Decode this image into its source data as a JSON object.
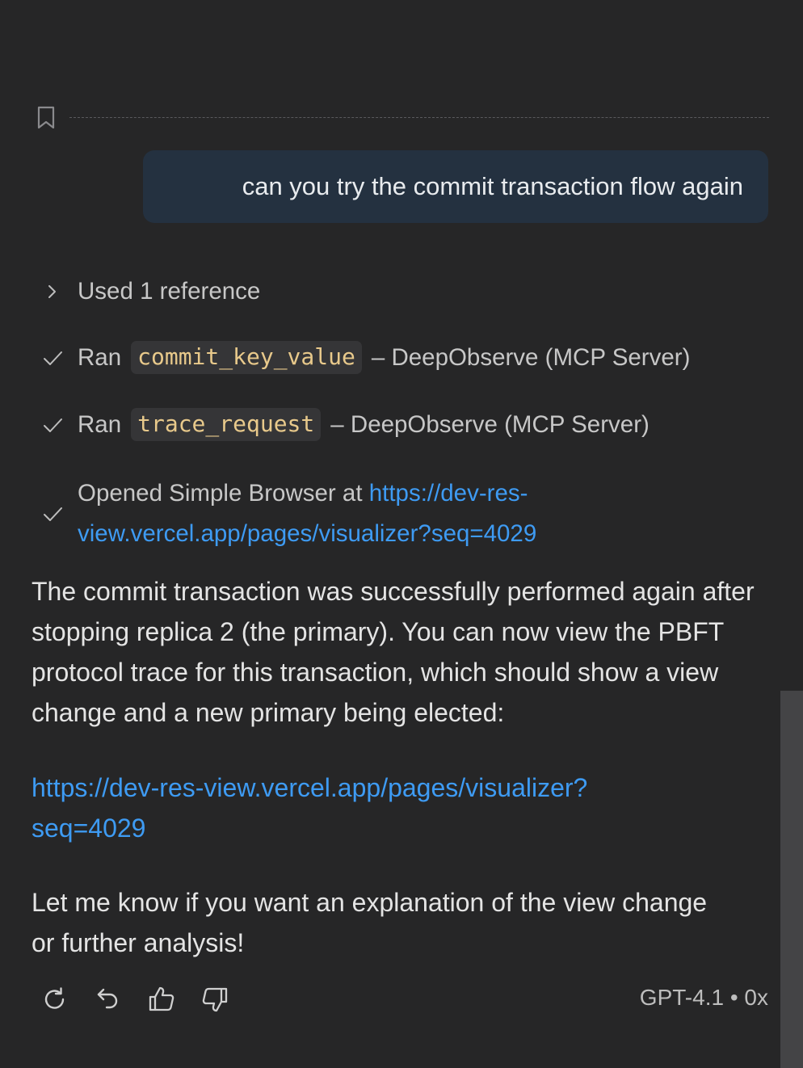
{
  "conversation": {
    "user_message": "can you try the commit transaction flow again",
    "steps": {
      "references": "Used 1 reference",
      "tool_1": {
        "prefix": "Ran",
        "tool_name": "commit_key_value",
        "suffix": "– DeepObserve (MCP Server)"
      },
      "tool_2": {
        "prefix": "Ran",
        "tool_name": "trace_request",
        "suffix": "– DeepObserve (MCP Server)"
      },
      "browser": {
        "prefix": "Opened Simple Browser at",
        "url": "https://dev-res-view.vercel.app/pages/visualizer?seq=4029"
      }
    },
    "response": {
      "paragraph_1": "The commit transaction was successfully performed again after stopping replica 2 (the primary). You can now view the PBFT protocol trace for this transaction, which should show a view change and a new primary being elected:",
      "link": "https://dev-res-view.vercel.app/pages/visualizer?seq=4029",
      "paragraph_2": "Let me know if you want an explanation of the view change or further analysis!"
    },
    "actions": {
      "retry_icon": "retry-icon",
      "undo_icon": "undo-icon",
      "thumbs_up_icon": "thumbs-up-icon",
      "thumbs_down_icon": "thumbs-down-icon"
    },
    "model_info": "GPT-4.1 • 0x"
  },
  "colors": {
    "background": "#262627",
    "user_bubble": "#243140",
    "link": "#3e9bf3",
    "code_text": "#e8c98b",
    "code_bg": "#353537"
  }
}
